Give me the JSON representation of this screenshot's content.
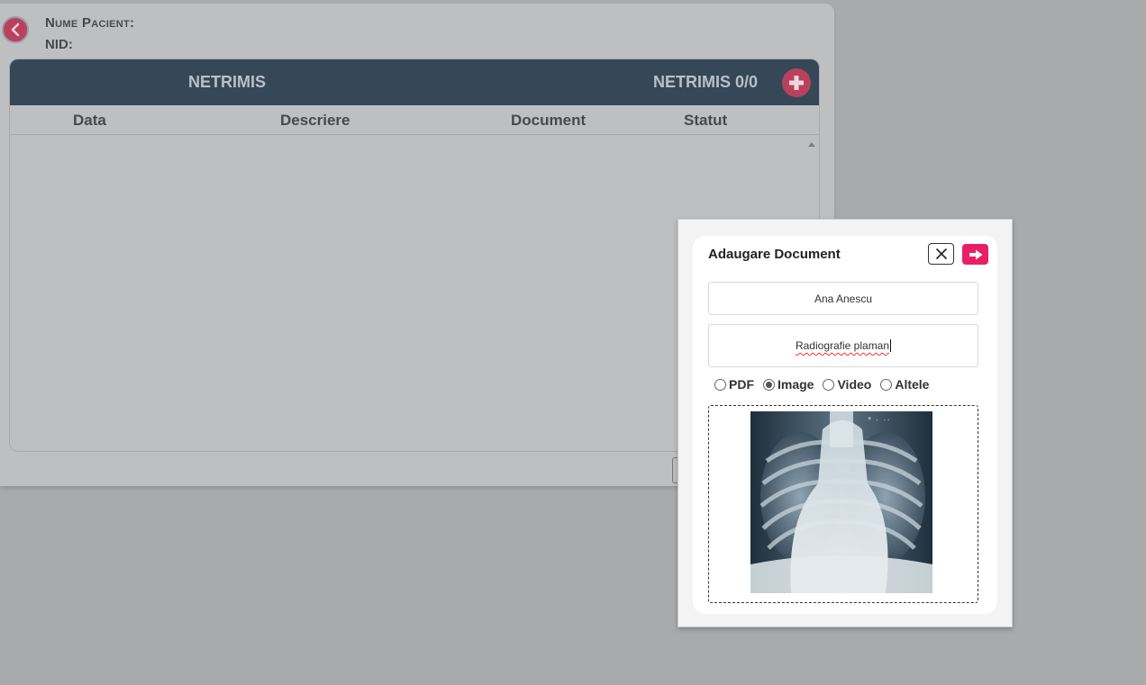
{
  "patient": {
    "name_label": "Nume Pacient:",
    "nid_label": "NID:"
  },
  "panel": {
    "title": "NETRIMIS",
    "count_label": "NETRIMIS 0/0",
    "columns": [
      "Data",
      "Descriere",
      "Document",
      "Statut"
    ]
  },
  "modal": {
    "title": "Adaugare Document",
    "patient_value": "Ana Anescu",
    "description_value": "Radiografie plaman",
    "file_types": [
      {
        "label": "PDF",
        "checked": false
      },
      {
        "label": "Image",
        "checked": true
      },
      {
        "label": "Video",
        "checked": false
      },
      {
        "label": "Altele",
        "checked": false
      }
    ]
  },
  "colors": {
    "header_bg": "#364758",
    "accent": "#e91e63",
    "back_button": "#b8415d"
  }
}
